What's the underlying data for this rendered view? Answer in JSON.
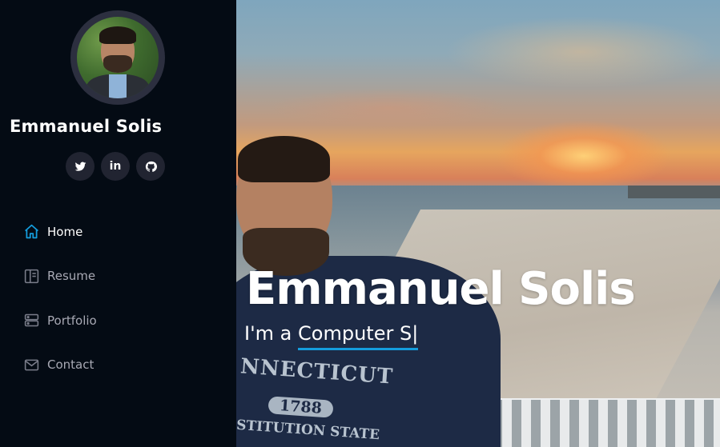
{
  "sidebar": {
    "profile_name": "Emmanuel Solis",
    "socials": [
      {
        "icon": "twitter-icon"
      },
      {
        "icon": "linkedin-icon",
        "label": "in"
      },
      {
        "icon": "github-icon"
      }
    ],
    "nav": [
      {
        "label": "Home",
        "icon": "home-icon",
        "active": true
      },
      {
        "label": "Resume",
        "icon": "file-icon",
        "active": false
      },
      {
        "label": "Portfolio",
        "icon": "server-icon",
        "active": false
      },
      {
        "label": "Contact",
        "icon": "envelope-icon",
        "active": false
      }
    ]
  },
  "hero": {
    "title": "Emmanuel Solis",
    "subtitle_prefix": "I'm a ",
    "subtitle_typed": "Computer S|",
    "hoodie_text": "NNECTICUT",
    "hoodie_number": "1788",
    "hoodie_subtext": "STITUTION STATE"
  },
  "colors": {
    "sidebar_bg": "#040b14",
    "accent": "#149ddd",
    "nav_inactive": "#a8a9b4",
    "social_bg": "#212431"
  }
}
